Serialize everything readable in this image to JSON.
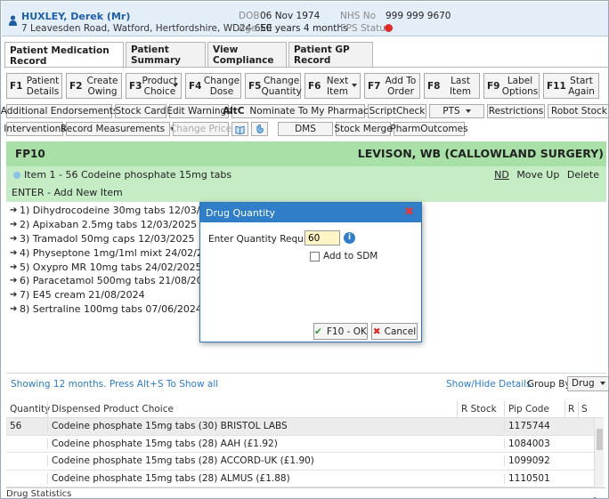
{
  "patient": {
    "name": "HUXLEY, Derek (Mr)",
    "address": "7 Leavesden Road, Watford, Hertfordshire, WD24 6EE",
    "dob_label": "DOB",
    "dob": "06 Nov 1974",
    "age_label": "Age",
    "age": "50 years 4 months",
    "nhs_label": "NHS No",
    "nhs": "999 999 9670",
    "eps_label": "EPS Status",
    "eps_color": "#e02a2a"
  },
  "tabs": [
    {
      "label": "Patient Medication Record",
      "active": true
    },
    {
      "label": "Patient Summary"
    },
    {
      "label": "View Compliance"
    },
    {
      "label": "Patient GP Record"
    }
  ],
  "fkeys": [
    {
      "key": "F1",
      "label": "Patient Details"
    },
    {
      "key": "F2",
      "label": "Create Owing"
    },
    {
      "key": "F3",
      "label": "Product Choice"
    },
    {
      "key": "F4",
      "label": "Change Dose"
    },
    {
      "key": "F5",
      "label": "Change Quantity"
    },
    {
      "key": "F6",
      "label": "Next Item"
    },
    {
      "key": "F7",
      "label": "Add To Order"
    },
    {
      "key": "F8",
      "label": "Last Item"
    },
    {
      "key": "F9",
      "label": "Label Options"
    },
    {
      "key": "F11",
      "label": "Start Again"
    }
  ],
  "row1": {
    "additional": "Additional Endorsements",
    "stock_card": "Stock Card",
    "edit_warnings": "Edit Warnings",
    "altc": "AltC",
    "nominate": "Nominate To My Pharmacy",
    "scriptcheck": "ScriptCheck",
    "pts": "PTS",
    "restrictions": "Restrictions",
    "robot": "Robot Stock E"
  },
  "row2": {
    "interventions": "Interventions",
    "record_measurements": "Record Measurements",
    "change_price": "Change Price",
    "dms": "DMS",
    "stock_merge": "Stock Merge",
    "pharmoutcomes": "PharmOutcomes"
  },
  "script": {
    "form": "FP10",
    "prescriber": "LEVISON, WB (CALLOWLAND SURGERY)",
    "item": "Item 1 - 56 Codeine phosphate 15mg tabs",
    "nd": "ND",
    "move_up": "Move Up",
    "delete": "Delete",
    "enter": "ENTER - Add New Item"
  },
  "history": [
    "1) Dihydrocodeine 30mg tabs 12/03/2025",
    "2) Apixaban 2.5mg tabs 12/03/2025",
    "3) Tramadol 50mg caps 12/03/2025",
    "4) Physeptone 1mg/1ml mixt 24/02/2025",
    "5) Oxypro MR 10mg tabs 24/02/2025",
    "6) Paracetamol 500mg tabs 21/08/2024",
    "7) E45 cream 21/08/2024",
    "8) Sertraline 100mg tabs 07/06/2024"
  ],
  "footer": {
    "showing": "Showing 12 months. Press Alt+S To Show all",
    "show_hide": "Show/Hide Details",
    "group_label": "Group By:",
    "group_value": "Drug"
  },
  "grid": {
    "headers": [
      "Quantity",
      "Dispensed Product Choice",
      "R Stock",
      "Pip Code",
      "R",
      "S"
    ],
    "rows": [
      {
        "qty": "56",
        "product": "Codeine phosphate 15mg tabs (30) BRISTOL LABS",
        "stock": "",
        "pip": "1175744"
      },
      {
        "qty": "",
        "product": "Codeine phosphate 15mg tabs (28) AAH (£1.92)",
        "stock": "",
        "pip": "1084003"
      },
      {
        "qty": "",
        "product": "Codeine phosphate 15mg tabs (28) ACCORD-UK (£1.90)",
        "stock": "",
        "pip": "1099092"
      },
      {
        "qty": "",
        "product": "Codeine phosphate 15mg tabs (28) ALMUS (£1.88)",
        "stock": "",
        "pip": "1110501"
      }
    ]
  },
  "drug_statistics": "Drug Statistics",
  "dialog": {
    "title": "Drug Quantity",
    "label": "Enter Quantity Required",
    "value": "60",
    "checkbox_label": "Add to SDM",
    "ok": "F10 - OK",
    "cancel": "Cancel"
  }
}
